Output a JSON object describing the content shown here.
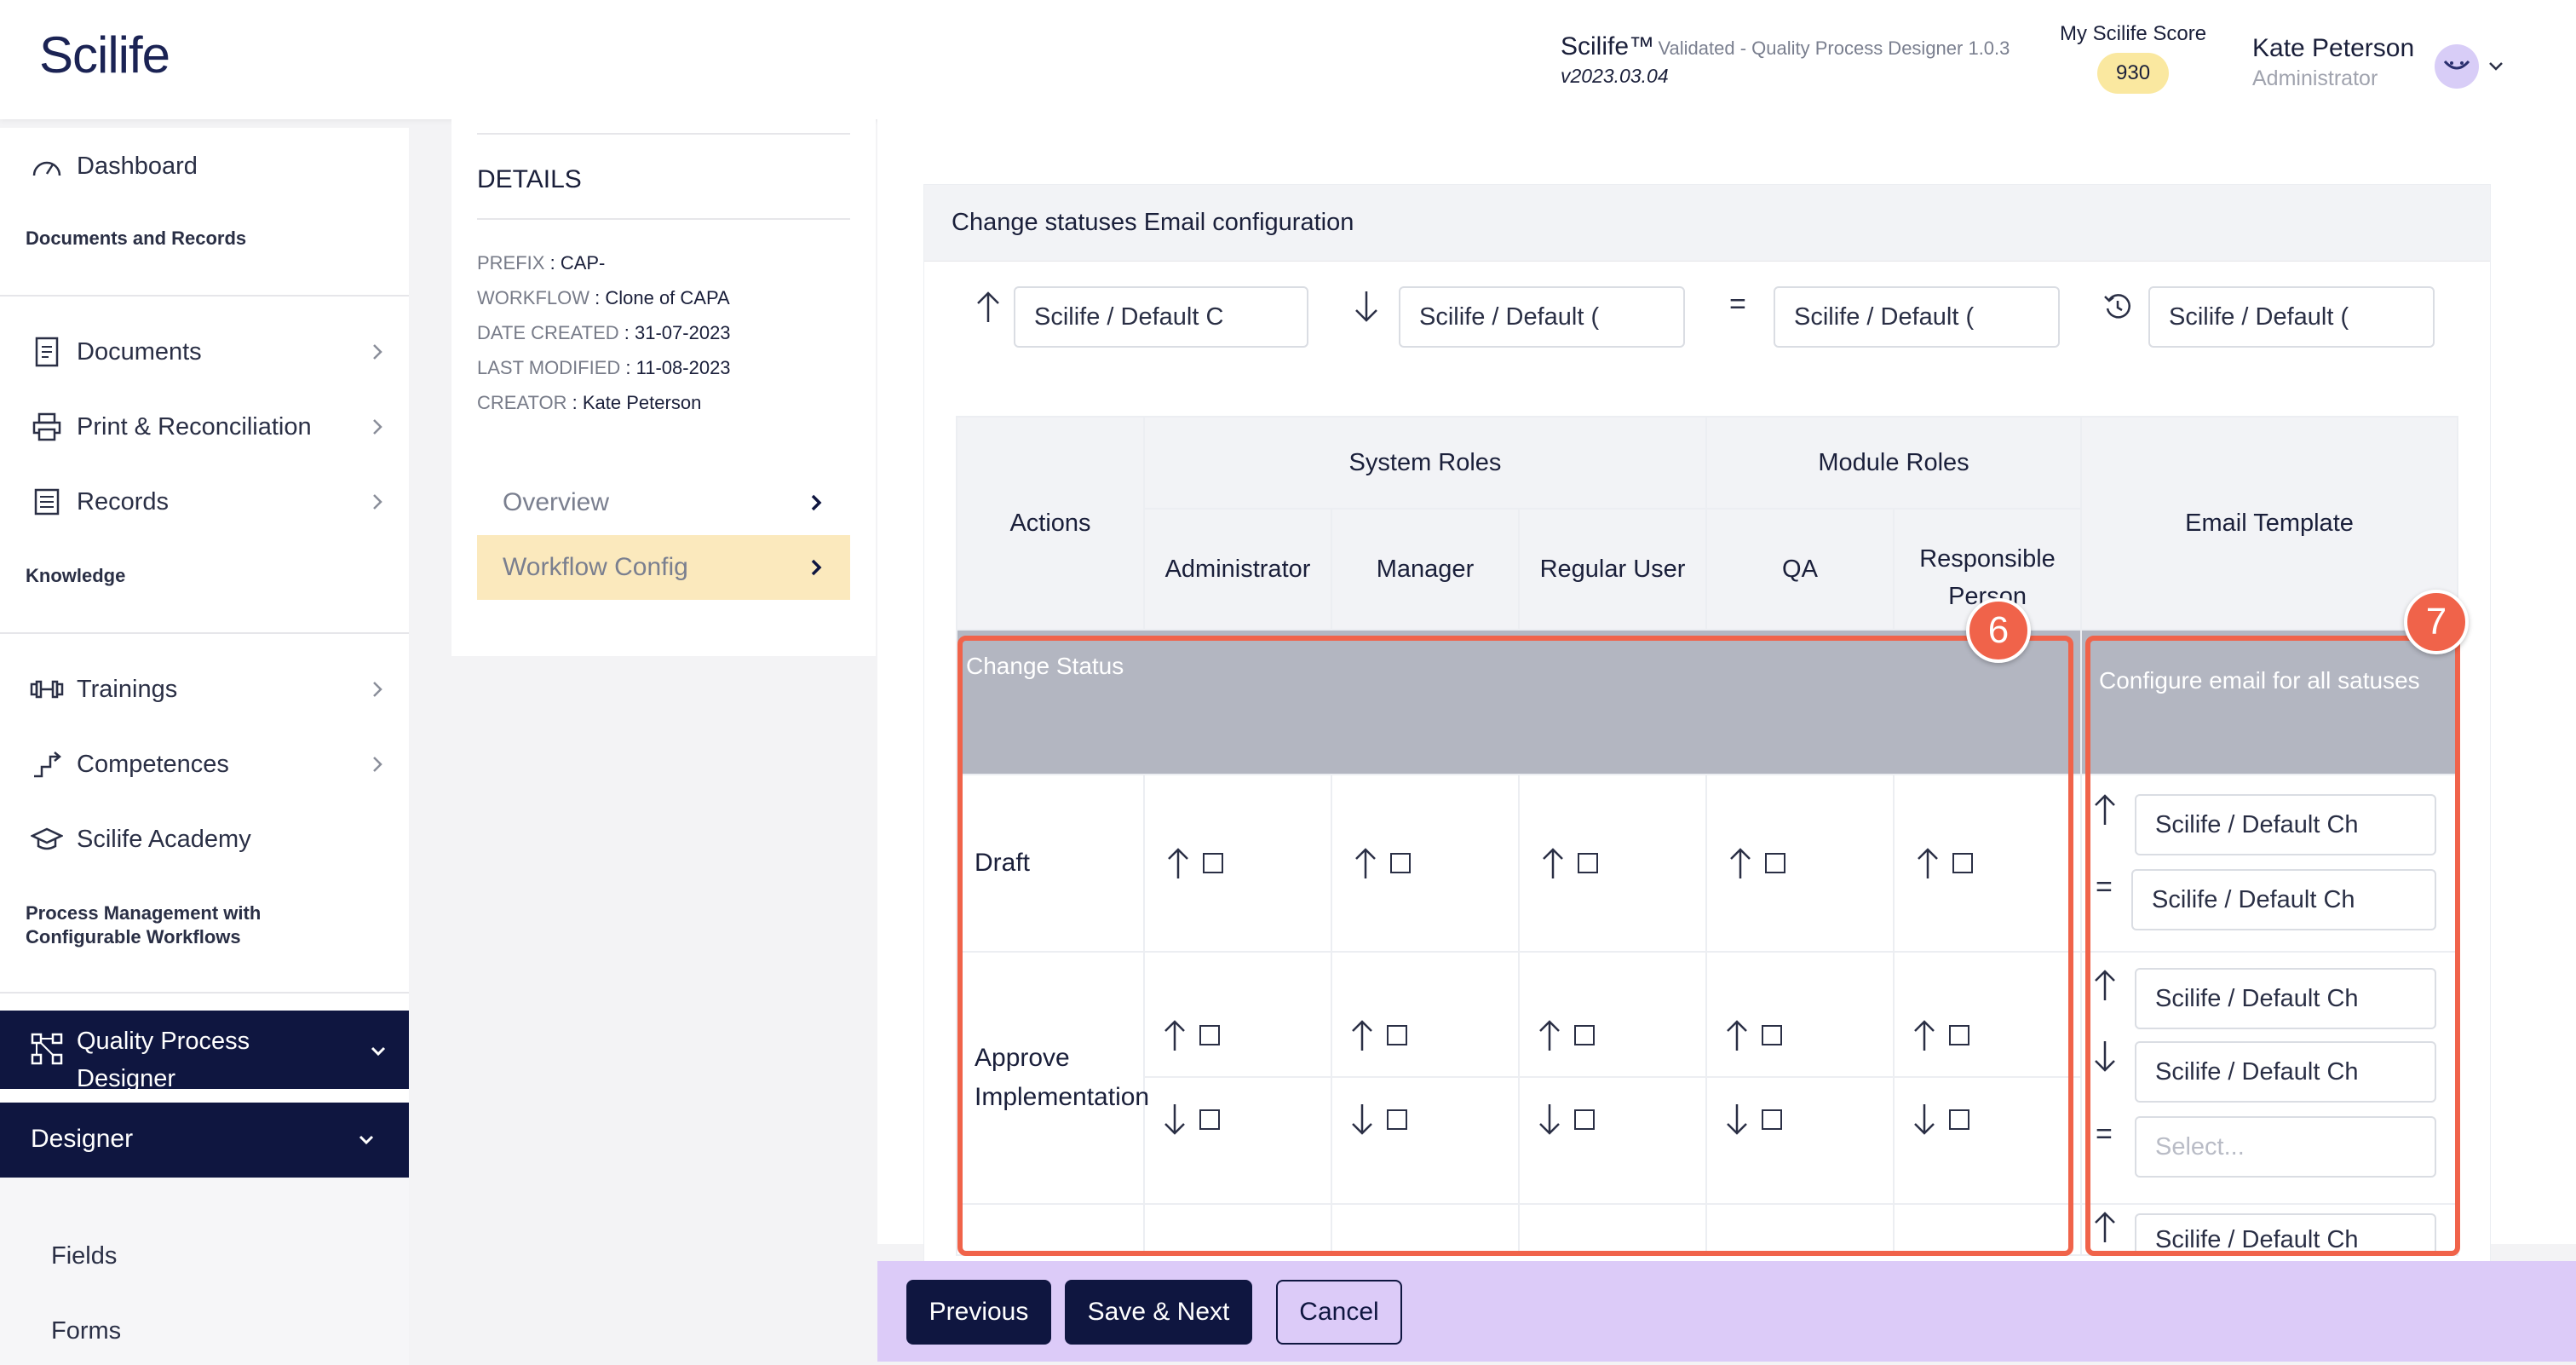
{
  "header": {
    "logo": "Scilife",
    "app_name": "Scilife™",
    "app_subtitle": "Validated - Quality Process Designer 1.0.3",
    "app_version": "v2023.03.04",
    "score_label": "My Scilife Score",
    "score_value": "930",
    "user_name": "Kate Peterson",
    "user_role": "Administrator"
  },
  "sidebar": {
    "dashboard": "Dashboard",
    "section_documents": "Documents and Records",
    "documents": "Documents",
    "print": "Print & Reconciliation",
    "records": "Records",
    "section_knowledge": "Knowledge",
    "trainings": "Trainings",
    "competences": "Competences",
    "academy": "Scilife Academy",
    "section_process": "Process Management with Configurable Workflows",
    "qpd": "Quality Process Designer",
    "designer": "Designer",
    "fields": "Fields",
    "forms": "Forms"
  },
  "details": {
    "title": "DETAILS",
    "prefix_key": "PREFIX",
    "prefix_val": "CAP-",
    "workflow_key": "WORKFLOW",
    "workflow_val": "Clone of CAPA",
    "created_key": "DATE CREATED",
    "created_val": "31-07-2023",
    "modified_key": "LAST MODIFIED",
    "modified_val": "11-08-2023",
    "creator_key": "CREATOR",
    "creator_val": "Kate Peterson",
    "tab_overview": "Overview",
    "tab_workflow": "Workflow Config"
  },
  "config": {
    "title": "Change statuses Email configuration",
    "default_up": "Scilife / Default C",
    "default_down": "Scilife / Default (",
    "default_equal": "Scilife / Default (",
    "default_history": "Scilife / Default ("
  },
  "table": {
    "col_actions": "Actions",
    "group_system": "System Roles",
    "group_module": "Module Roles",
    "col_email": "Email Template",
    "roles": [
      "Administrator",
      "Manager",
      "Regular User",
      "QA",
      "Responsible Person"
    ],
    "group_label": "Change Status",
    "group_email": "Configure email for all satuses",
    "row_draft": "Draft",
    "row_approve": "Approve Implementation",
    "tmpl_draft_up": "Scilife / Default Ch",
    "tmpl_draft_eq": "Scilife / Default Ch",
    "tmpl_appr_up": "Scilife / Default Ch",
    "tmpl_appr_down": "Scilife / Default Ch",
    "tmpl_appr_eq_placeholder": "Select...",
    "tmpl_next_up": "Scilife / Default Ch"
  },
  "annotations": {
    "badge_6": "6",
    "badge_7": "7"
  },
  "footer": {
    "previous": "Previous",
    "save_next": "Save & Next",
    "cancel": "Cancel"
  },
  "colors": {
    "navy": "#0f1640",
    "highlight": "#f0634a",
    "active_tab": "#fbe9bd",
    "footer": "#dccbf8",
    "group_row": "#b3b6c1"
  }
}
